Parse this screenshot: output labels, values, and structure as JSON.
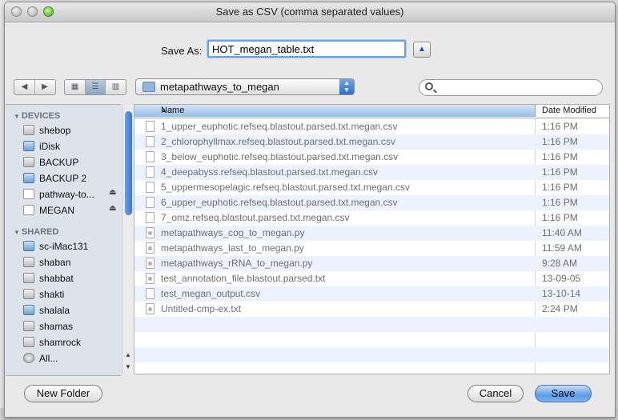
{
  "window": {
    "title": "Save as CSV (comma separated values)"
  },
  "save_as": {
    "label": "Save As:",
    "value": "HOT_megan_table.txt"
  },
  "location": {
    "folder": "metapathways_to_megan"
  },
  "search": {
    "placeholder": ""
  },
  "sidebar": {
    "devices_header": "DEVICES",
    "devices": [
      {
        "label": "shebop",
        "icon": "drive-icon"
      },
      {
        "label": "iDisk",
        "icon": "idisk-icon"
      },
      {
        "label": "BACKUP",
        "icon": "drive-icon"
      },
      {
        "label": "BACKUP 2",
        "icon": "backup-drive-icon"
      },
      {
        "label": "pathway-to...",
        "icon": "disk-image-icon",
        "eject": "⏏"
      },
      {
        "label": "MEGAN",
        "icon": "disk-image-icon",
        "eject": "⏏"
      }
    ],
    "shared_header": "SHARED",
    "shared": [
      {
        "label": "sc-iMac131",
        "icon": "imac-icon"
      },
      {
        "label": "shaban",
        "icon": "server-icon"
      },
      {
        "label": "shabbat",
        "icon": "server-icon"
      },
      {
        "label": "shakti",
        "icon": "server-icon"
      },
      {
        "label": "shalala",
        "icon": "imac-icon"
      },
      {
        "label": "shamas",
        "icon": "server-icon"
      },
      {
        "label": "shamrock",
        "icon": "server-icon"
      },
      {
        "label": "All...",
        "icon": "network-icon"
      }
    ]
  },
  "columns": {
    "name": "Name",
    "date": "Date Modified"
  },
  "files": [
    {
      "name": "1_upper_euphotic.refseq.blastout.parsed.txt.megan.csv",
      "date": "1:16 PM",
      "type": "doc"
    },
    {
      "name": "2_chlorophyllmax.refseq.blastout.parsed.txt.megan.csv",
      "date": "1:16 PM",
      "type": "doc"
    },
    {
      "name": "3_below_euphotic.refseq.blastout.parsed.txt.megan.csv",
      "date": "1:16 PM",
      "type": "doc"
    },
    {
      "name": "4_deepabyss.refseq.blastout.parsed.txt.megan.csv",
      "date": "1:16 PM",
      "type": "doc"
    },
    {
      "name": "5_uppermesopelagic.refseq.blastout.parsed.txt.megan.csv",
      "date": "1:16 PM",
      "type": "doc"
    },
    {
      "name": "6_upper_euphotic.refseq.blastout.parsed.txt.megan.csv",
      "date": "1:16 PM",
      "type": "doc"
    },
    {
      "name": "7_omz.refseq.blastout.parsed.txt.megan.csv",
      "date": "1:16 PM",
      "type": "doc"
    },
    {
      "name": "metapathways_cog_to_megan.py",
      "date": "11:40 AM",
      "type": "py"
    },
    {
      "name": "metapathways_last_to_megan.py",
      "date": "11:59 AM",
      "type": "py"
    },
    {
      "name": "metapathways_rRNA_to_megan.py",
      "date": "9:28 AM",
      "type": "py"
    },
    {
      "name": "test_annotation_file.blastout.parsed.txt",
      "date": "13-09-05",
      "type": "py"
    },
    {
      "name": "test_megan_output.csv",
      "date": "13-10-14",
      "type": "doc"
    },
    {
      "name": "Untitled-cmp-ex.txt",
      "date": "2:24 PM",
      "type": "py"
    }
  ],
  "buttons": {
    "new_folder": "New Folder",
    "cancel": "Cancel",
    "save": "Save"
  }
}
